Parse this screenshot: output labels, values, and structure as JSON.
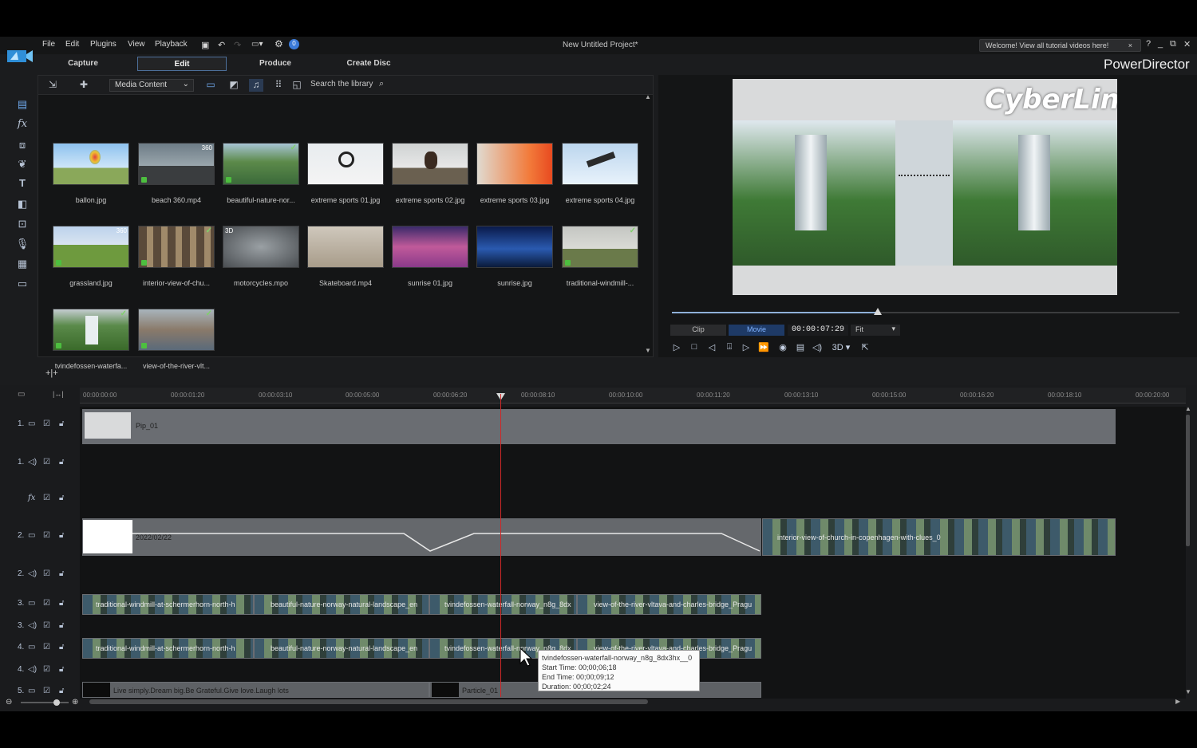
{
  "menu": {
    "items": [
      "File",
      "Edit",
      "Plugins",
      "View",
      "Playback"
    ],
    "project_title": "New Untitled Project*",
    "welcome": "Welcome! View all tutorial videos here!",
    "brand": "PowerDirector"
  },
  "modes": {
    "capture": "Capture",
    "edit": "Edit",
    "produce": "Produce",
    "create_disc": "Create Disc"
  },
  "library": {
    "dropdown": "Media Content",
    "search_placeholder": "Search the library",
    "items": [
      {
        "label": "ballon.jpg",
        "tag": ""
      },
      {
        "label": "beach 360.mp4",
        "tag": "360"
      },
      {
        "label": "beautiful-nature-nor...",
        "tag": ""
      },
      {
        "label": "extreme sports 01.jpg",
        "tag": ""
      },
      {
        "label": "extreme sports 02.jpg",
        "tag": ""
      },
      {
        "label": "extreme sports 03.jpg",
        "tag": ""
      },
      {
        "label": "extreme sports 04.jpg",
        "tag": ""
      },
      {
        "label": "grassland.jpg",
        "tag": "360"
      },
      {
        "label": "interior-view-of-chu...",
        "tag": ""
      },
      {
        "label": "motorcycles.mpo",
        "tag": "3D"
      },
      {
        "label": "Skateboard.mp4",
        "tag": ""
      },
      {
        "label": "sunrise 01.jpg",
        "tag": ""
      },
      {
        "label": "sunrise.jpg",
        "tag": ""
      },
      {
        "label": "traditional-windmill-...",
        "tag": ""
      },
      {
        "label": "tvindefossen-waterfa...",
        "tag": ""
      },
      {
        "label": "view-of-the-river-vlt...",
        "tag": ""
      }
    ]
  },
  "preview": {
    "watermark": "CyberLink",
    "progress": 0.405,
    "clip_label": "Clip",
    "movie_label": "Movie",
    "timecode": "00:00:07:29",
    "fit": "Fit",
    "three_d": "3D"
  },
  "timeline": {
    "ruler": [
      "00:00:00:00",
      "00:00:01:20",
      "00:00:03:10",
      "00:00:05:00",
      "00:00:06:20",
      "00:00:08:10",
      "00:00:10:00",
      "00:00:11:20",
      "00:00:13:10",
      "00:00:15:00",
      "00:00:16:20",
      "00:00:18:10",
      "00:00:20:00"
    ],
    "tracks": [
      "1.",
      "1.",
      "",
      "2.",
      "2.",
      "3.",
      "3.",
      "4.",
      "4.",
      "5."
    ],
    "clips": {
      "pip": "Pip_01",
      "track2_a": "2022/02/22",
      "track2_b": "interior-view-of-church-in-copenhagen-with-clues_0",
      "t3_a": "traditional-windmill-at-schermerhorn-north-h",
      "t3_b": "beautiful-nature-norway-natural-landscape_en",
      "t3_c": "tvindefossen-waterfall-norway_n8g_8dx",
      "t3_d": "view-of-the-river-vltava-and-charles-bridge_Pragu",
      "t4_a": "traditional-windmill-at-schermerhorn-north-h",
      "t4_b": "beautiful-nature-norway-natural-landscape_en",
      "t4_c": "tvindefossen-waterfall-norway_n8g_8dx",
      "t4_d": "view-of-the-river-vltava-and-charles-bridge_Pragu",
      "t5_a": "Live simply.Dream big.Be Grateful.Give love.Laugh lots",
      "t5_b": "Particle_01"
    },
    "tooltip": {
      "title": "tvindefossen-waterfall-norway_n8g_8dx3hx__0",
      "start": "Start Time: 00;00;06;18",
      "end": "End Time: 00;00;09;12",
      "duration": "Duration: 00;00;02;24"
    }
  }
}
